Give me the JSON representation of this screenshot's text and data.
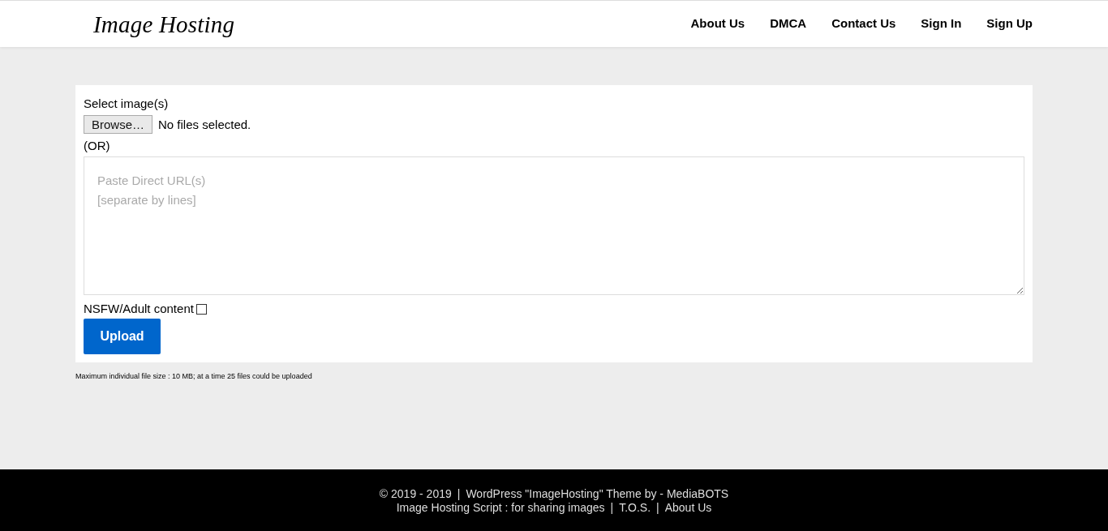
{
  "header": {
    "logo": "Image Hosting",
    "nav": [
      {
        "label": "About Us"
      },
      {
        "label": "DMCA"
      },
      {
        "label": "Contact Us"
      },
      {
        "label": "Sign In"
      },
      {
        "label": "Sign Up"
      }
    ]
  },
  "upload_form": {
    "select_label": "Select image(s)",
    "browse_button": "Browse…",
    "file_status": "No files selected.",
    "or_label": "(OR)",
    "url_field": {
      "placeholder": "Paste Direct URL(s)\n[separate by lines]"
    },
    "nsfw": {
      "label": "NSFW/Adult content",
      "checked": false
    },
    "upload_button": "Upload"
  },
  "note": "Maximum individual file size : 10 MB; at a time 25 files could be uploaded",
  "footer": {
    "lines": [
      [
        {
          "kind": "text",
          "text": "© 2019 - 2019"
        },
        {
          "kind": "separator",
          "text": "|"
        },
        {
          "kind": "text",
          "text": "WordPress \"ImageHosting\" Theme by - MediaBOTS"
        }
      ],
      [
        {
          "kind": "link",
          "text": "Image Hosting Script : for sharing images"
        },
        {
          "kind": "separator",
          "text": "|"
        },
        {
          "kind": "link",
          "text": "T.O.S."
        },
        {
          "kind": "separator",
          "text": "|"
        },
        {
          "kind": "link",
          "text": "About Us"
        }
      ]
    ]
  }
}
